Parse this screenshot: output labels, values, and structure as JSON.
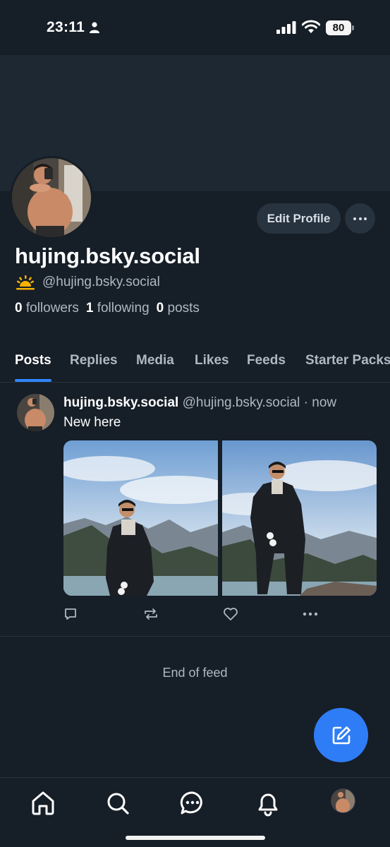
{
  "status_bar": {
    "time": "23:11",
    "battery": "80"
  },
  "profile": {
    "display_name": "hujing.bsky.social",
    "handle": "@hujing.bsky.social",
    "edit_button": "Edit Profile",
    "stats": {
      "followers_count": "0",
      "followers_label": "followers",
      "following_count": "1",
      "following_label": "following",
      "posts_count": "0",
      "posts_label": "posts"
    }
  },
  "tabs": [
    {
      "label": "Posts",
      "active": true
    },
    {
      "label": "Replies"
    },
    {
      "label": "Media"
    },
    {
      "label": "Likes"
    },
    {
      "label": "Feeds"
    },
    {
      "label": "Starter Packs"
    }
  ],
  "post": {
    "author_name": "hujing.bsky.social",
    "author_handle": "@hujing.bsky.social",
    "separator": "·",
    "time": "now",
    "text": "New here",
    "actions": [
      "reply-icon",
      "repost-icon",
      "like-icon",
      "more-icon"
    ]
  },
  "feed_end": "End of feed",
  "bottom_nav": [
    "home-icon",
    "search-icon",
    "chat-icon",
    "notifications-icon",
    "profile-avatar"
  ],
  "colors": {
    "background": "#161e27",
    "banner": "#1d2833",
    "accent": "#2f87ff",
    "fab": "#2f7df6",
    "muted_text": "#aeb8c3"
  }
}
